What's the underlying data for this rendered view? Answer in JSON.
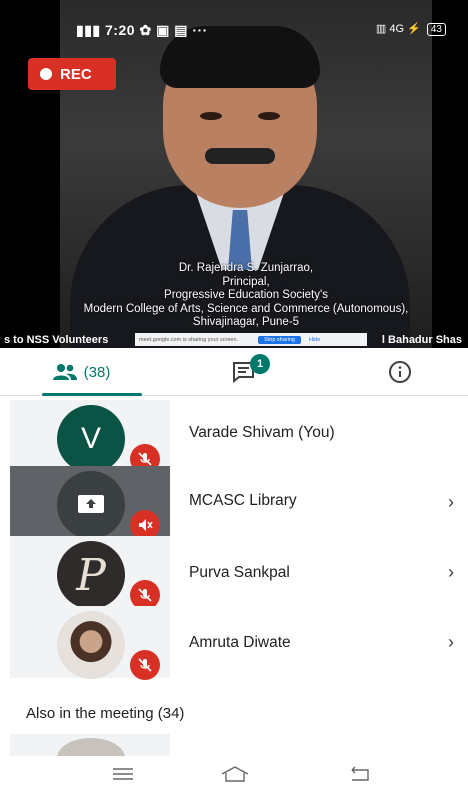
{
  "status_bar": {
    "time": "7:20",
    "signal_text": "4G",
    "battery": "43"
  },
  "recording": {
    "label": "REC"
  },
  "caption": {
    "lines": [
      "Dr. Rajendra S. Zunjarrao,",
      "Principal,",
      "Progressive Education Society's",
      "Modern College of Arts, Science and Commerce (Autonomous),",
      "Shivajinagar, Pune-5"
    ]
  },
  "ticker": {
    "left_text": "s to NSS Volunteers",
    "right_text": "l Bahadur Shas"
  },
  "screen_share_banner": {
    "message": "meet.google.com is sharing your screen.",
    "stop_label": "Stop sharing",
    "hide_label": "Hide"
  },
  "tabs": {
    "people_count": "(38)",
    "chat_unread": "1"
  },
  "participants": [
    {
      "name": "Varade Shivam (You)",
      "initial": "V",
      "muted": true,
      "has_chevron": false
    },
    {
      "name": "MCASC Library",
      "initial": "",
      "muted": true,
      "has_chevron": true
    },
    {
      "name": "Purva Sankpal",
      "initial": "P",
      "muted": true,
      "has_chevron": true
    },
    {
      "name": "Amruta Diwate",
      "initial": "",
      "muted": true,
      "has_chevron": true
    }
  ],
  "also_in_meeting": {
    "label": "Also in the meeting (34)"
  },
  "colors": {
    "accent": "#00796b",
    "rec_red": "#d93025",
    "mute_red": "#d93025"
  }
}
